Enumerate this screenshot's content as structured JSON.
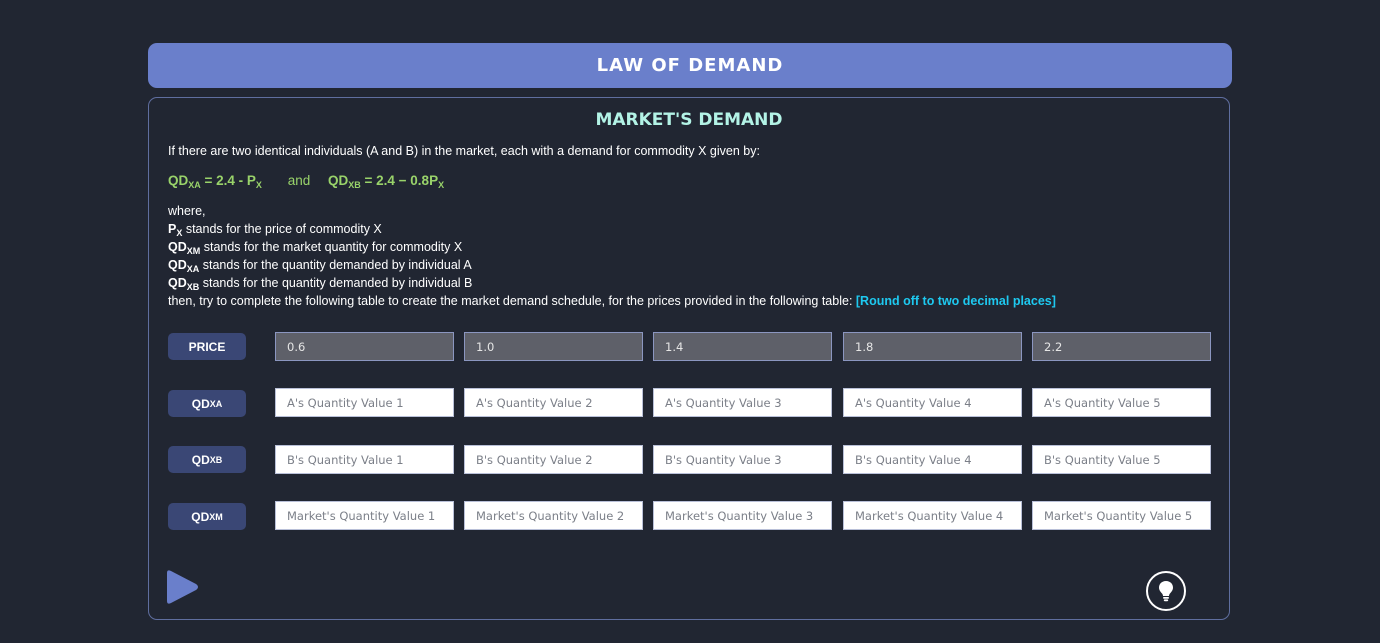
{
  "header": {
    "title": "LAW OF DEMAND"
  },
  "section": {
    "title": "MARKET'S DEMAND"
  },
  "intro": "If there are two identical individuals (A and B) in the market, each with a demand for commodity X given by:",
  "equations": {
    "a": {
      "prefix": "QD",
      "sub": "XA",
      "rhs": " = 2.4 - P",
      "rhs_sub": "X"
    },
    "joiner": "and",
    "b": {
      "prefix": "QD",
      "sub": "XB",
      "rhs": " = 2.4 − 0.8P",
      "rhs_sub": "X"
    }
  },
  "definitions": {
    "where": "where,",
    "items": [
      {
        "symbol": "P",
        "sub": "X",
        "text": " stands for the price of commodity X"
      },
      {
        "symbol": "QD",
        "sub": "XM",
        "text": " stands for the market quantity for commodity X"
      },
      {
        "symbol": "QD",
        "sub": "XA",
        "text": " stands for the quantity demanded by individual A"
      },
      {
        "symbol": "QD",
        "sub": "XB",
        "text": " stands for the quantity demanded by individual B"
      }
    ],
    "instruction": "then, try to complete the following table to create the market demand schedule, for the prices provided in the following table: ",
    "hint": "[Round off to two decimal places]"
  },
  "table": {
    "price_label": "PRICE",
    "prices": [
      "0.6",
      "1.0",
      "1.4",
      "1.8",
      "2.2"
    ],
    "rows": [
      {
        "label": "QD",
        "label_sub": "XA",
        "placeholders": [
          "A's Quantity Value 1",
          "A's Quantity Value 2",
          "A's Quantity Value 3",
          "A's Quantity Value 4",
          "A's Quantity Value 5"
        ]
      },
      {
        "label": "QD",
        "label_sub": "XB",
        "placeholders": [
          "B's Quantity Value 1",
          "B's Quantity Value 2",
          "B's Quantity Value 3",
          "B's Quantity Value 4",
          "B's Quantity Value 5"
        ]
      },
      {
        "label": "QD",
        "label_sub": "XM",
        "placeholders": [
          "Market's Quantity Value 1",
          "Market's Quantity Value 2",
          "Market's Quantity Value 3",
          "Market's Quantity Value 4",
          "Market's Quantity Value 5"
        ]
      }
    ]
  },
  "controls": {
    "play_icon": "play-icon",
    "hint_icon": "lightbulb-icon"
  },
  "colors": {
    "background": "#212632",
    "header": "#6a7fcb",
    "section_title": "#b3f3e6",
    "equation": "#99d36a",
    "hint": "#1ec9f0",
    "row_label": "#3a4775"
  }
}
